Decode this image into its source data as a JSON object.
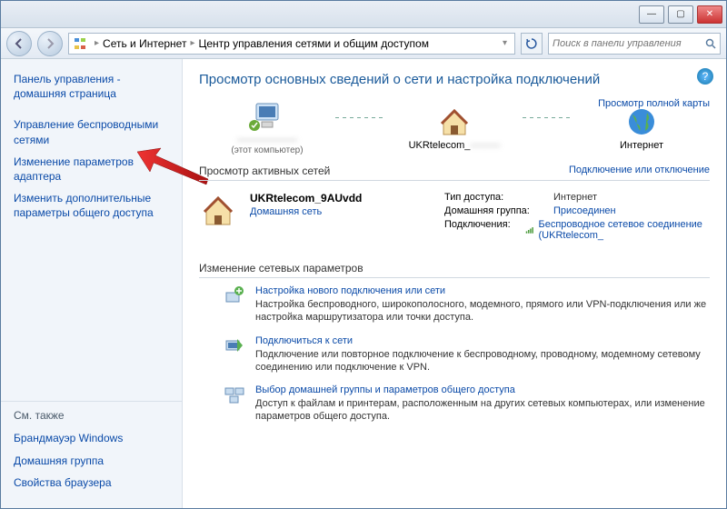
{
  "window": {
    "minimize": "—",
    "maximize": "▢",
    "close": "✕"
  },
  "breadcrumb": {
    "item1": "Сеть и Интернет",
    "item2": "Центр управления сетями и общим доступом"
  },
  "search": {
    "placeholder": "Поиск в панели управления"
  },
  "sidebar": {
    "home": "Панель управления - домашняя страница",
    "wireless": "Управление беспроводными сетями",
    "adapter": "Изменение параметров адаптера",
    "sharing": "Изменить дополнительные параметры общего доступа",
    "also_title": "См. также",
    "firewall": "Брандмауэр Windows",
    "homegroup": "Домашняя группа",
    "browser": "Свойства браузера"
  },
  "main": {
    "heading": "Просмотр основных сведений о сети и настройка подключений",
    "maplink": "Просмотр полной карты",
    "node1_name": "——————",
    "node1_sub": "(этот компьютер)",
    "node2_name": "UKRtelecom_",
    "node2_name2": "———",
    "node3_name": "Интернет",
    "active_title": "Просмотр активных сетей",
    "active_link": "Подключение или отключение",
    "network_name": "UKRtelecom_9AUvdd",
    "network_type": "Домашняя сеть",
    "detail_type_label": "Тип доступа:",
    "detail_type_value": "Интернет",
    "detail_group_label": "Домашняя группа:",
    "detail_group_value": "Присоединен",
    "detail_conn_label": "Подключения:",
    "detail_conn_value": "Беспроводное сетевое соединение (UKRtelecom_",
    "chg_title": "Изменение сетевых параметров",
    "task1_link": "Настройка нового подключения или сети",
    "task1_desc": "Настройка беспроводного, широкополосного, модемного, прямого или VPN-подключения или же настройка маршрутизатора или точки доступа.",
    "task2_link": "Подключиться к сети",
    "task2_desc": "Подключение или повторное подключение к беспроводному, проводному, модемному сетевому соединению или подключение к VPN.",
    "task3_link": "Выбор домашней группы и параметров общего доступа",
    "task3_desc": "Доступ к файлам и принтерам, расположенным на других сетевых компьютерах, или изменение параметров общего доступа."
  },
  "colors": {
    "link": "#0a4aa8",
    "accent": "#1a5a9a"
  }
}
